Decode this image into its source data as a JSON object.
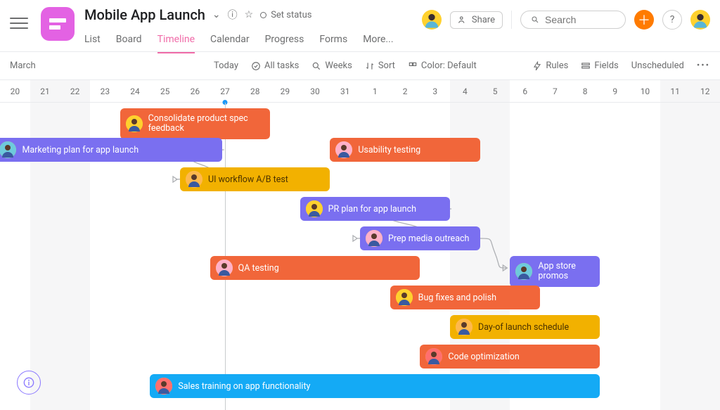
{
  "header": {
    "title": "Mobile App Launch",
    "status_label": "Set status",
    "share_label": "Share",
    "search_placeholder": "Search"
  },
  "tabs": [
    "List",
    "Board",
    "Timeline",
    "Calendar",
    "Progress",
    "Forms",
    "More..."
  ],
  "active_tab": "Timeline",
  "toolbar": {
    "month": "March",
    "today": "Today",
    "all_tasks": "All tasks",
    "weeks": "Weeks",
    "sort": "Sort",
    "color": "Color: Default",
    "rules": "Rules",
    "fields": "Fields",
    "unscheduled": "Unscheduled"
  },
  "days": [
    "20",
    "21",
    "22",
    "23",
    "24",
    "25",
    "26",
    "27",
    "28",
    "29",
    "30",
    "31",
    "1",
    "2",
    "3",
    "4",
    "5",
    "6",
    "7",
    "8",
    "9",
    "10",
    "11",
    "12"
  ],
  "weekend_idx": [
    1,
    2,
    15,
    16,
    22,
    23
  ],
  "today_idx": 7,
  "tasks": [
    {
      "id": "consolidate",
      "label": "Consolidate product spec feedback",
      "color": "c-orange",
      "row": 0,
      "start": 4,
      "span": 5,
      "tall": true,
      "avatar": "a1"
    },
    {
      "id": "marketing",
      "label": "Marketing plan for app launch",
      "color": "c-purple",
      "row": 1,
      "start": -0.2,
      "span": 7.6,
      "avatar": "a2"
    },
    {
      "id": "usability",
      "label": "Usability testing",
      "color": "c-orange",
      "row": 1,
      "start": 11,
      "span": 5,
      "avatar": "a3"
    },
    {
      "id": "abtest",
      "label": "UI workflow A/B test",
      "color": "c-yellow",
      "row": 2,
      "start": 6,
      "span": 5,
      "avatar": "a4"
    },
    {
      "id": "pr",
      "label": "PR plan for app launch",
      "color": "c-purple",
      "row": 3,
      "start": 10,
      "span": 5,
      "avatar": "a1"
    },
    {
      "id": "prep",
      "label": "Prep media outreach",
      "color": "c-purple",
      "row": 4,
      "start": 12,
      "span": 4,
      "avatar": "a3"
    },
    {
      "id": "qa",
      "label": "QA testing",
      "color": "c-orange",
      "row": 5,
      "start": 7,
      "span": 7,
      "avatar": "a3"
    },
    {
      "id": "appstore",
      "label": "App store promos",
      "color": "c-purple",
      "row": 5,
      "start": 17,
      "span": 3,
      "tall": true,
      "avatar": "a2"
    },
    {
      "id": "bugfix",
      "label": "Bug fixes and polish",
      "color": "c-orange",
      "row": 6,
      "start": 13,
      "span": 5,
      "avatar": "a1"
    },
    {
      "id": "dayof",
      "label": "Day-of launch schedule",
      "color": "c-yellow",
      "row": 7,
      "start": 15,
      "span": 5,
      "avatar": "a4"
    },
    {
      "id": "codeopt",
      "label": "Code optimization",
      "color": "c-orange",
      "row": 8,
      "start": 14,
      "span": 6,
      "avatar": "a5"
    },
    {
      "id": "sales",
      "label": "Sales training on app functionality",
      "color": "c-blue",
      "row": 9,
      "start": 5,
      "span": 15,
      "avatar": "a5"
    }
  ],
  "dependencies": [
    {
      "from": "marketing",
      "to": "abtest"
    },
    {
      "from": "pr",
      "to": "prep"
    },
    {
      "from": "prep",
      "to": "appstore"
    }
  ],
  "avatars": {
    "a1": "#ffd12e",
    "a2": "#6ecadc",
    "a3": "#ffb0c8",
    "a4": "#ffb84d",
    "a5": "#ff6f6f"
  }
}
